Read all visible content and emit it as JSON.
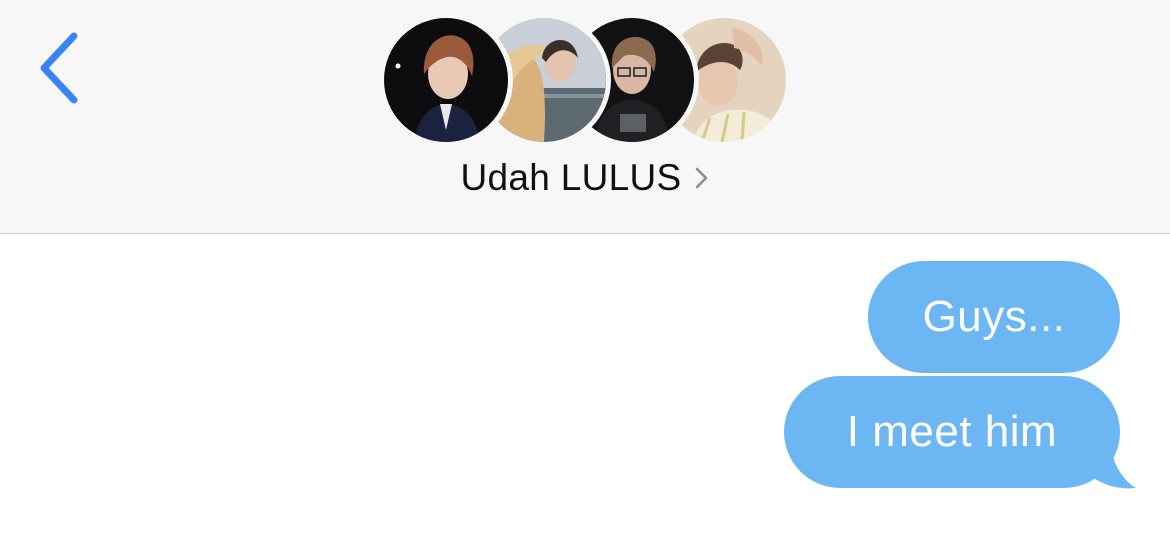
{
  "header": {
    "back_icon": "chevron-left-icon",
    "group_name": "Udah LULUS",
    "detail_icon": "chevron-right-icon",
    "avatar_count": 4
  },
  "messages": [
    {
      "from": "me",
      "text": "Guys..."
    },
    {
      "from": "me",
      "text": "I meet him"
    }
  ],
  "colors": {
    "accent": "#3a82f7",
    "bubble": "#6cb6f3",
    "header_bg": "#f7f7f7",
    "background": "#ffffff"
  }
}
